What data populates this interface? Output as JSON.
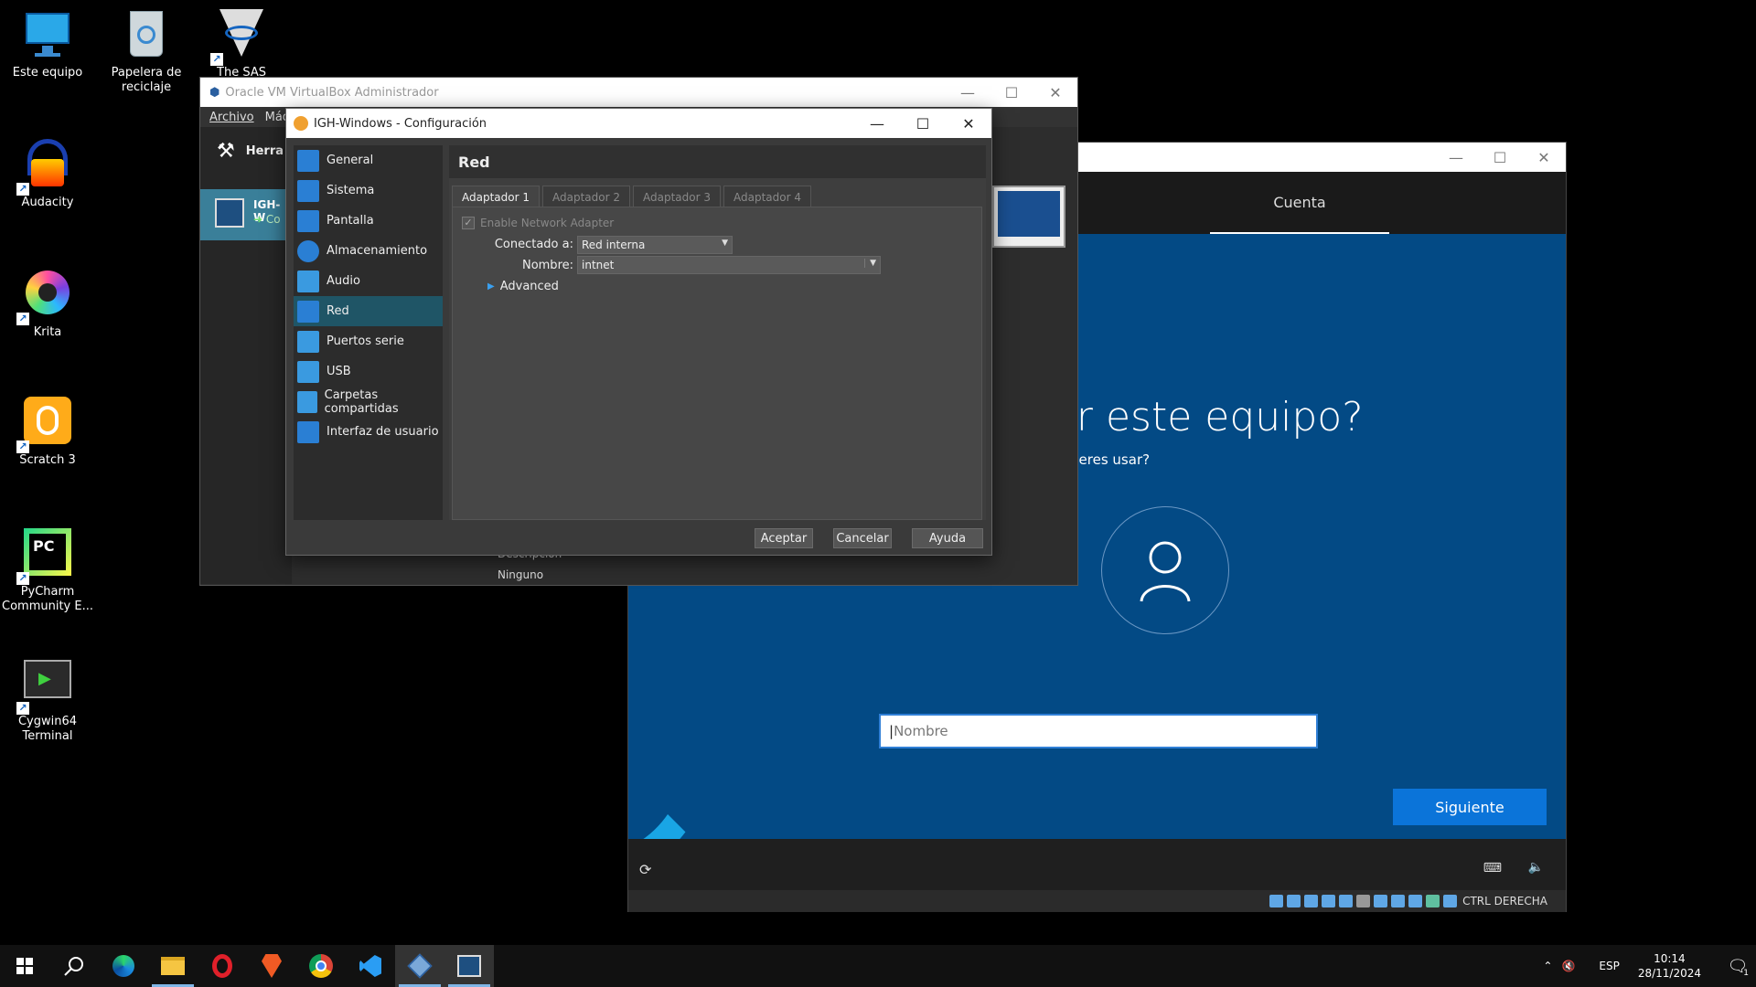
{
  "desktop_icons": [
    {
      "label": "Este equipo",
      "icon": "computer-icon"
    },
    {
      "label": "Papelera de reciclaje",
      "icon": "recycle-bin-icon"
    },
    {
      "label": "The SAS System",
      "icon": "sas-icon"
    },
    {
      "label": "Audacity",
      "icon": "audacity-icon"
    },
    {
      "label": "Krita",
      "icon": "krita-icon"
    },
    {
      "label": "Scratch 3",
      "icon": "scratch-icon"
    },
    {
      "label": "PyCharm Community E...",
      "icon": "pycharm-icon"
    },
    {
      "label": "Cygwin64 Terminal",
      "icon": "cygwin-icon"
    }
  ],
  "manager": {
    "title": "Oracle VM VirtualBox Administrador",
    "menu": [
      "Archivo",
      "Máqu"
    ],
    "tools_label": "Herra",
    "vm_label": "IGH-W",
    "vm_state": "Co",
    "detail_section": "Descripción",
    "detail_value": "Ninguno"
  },
  "dialog": {
    "title": "IGH-Windows - Configuración",
    "nav": [
      {
        "label": "General",
        "icon": "general-icon"
      },
      {
        "label": "Sistema",
        "icon": "system-icon"
      },
      {
        "label": "Pantalla",
        "icon": "display-icon"
      },
      {
        "label": "Almacenamiento",
        "icon": "storage-icon"
      },
      {
        "label": "Audio",
        "icon": "audio-icon"
      },
      {
        "label": "Red",
        "icon": "network-icon",
        "active": true
      },
      {
        "label": "Puertos serie",
        "icon": "serial-port-icon"
      },
      {
        "label": "USB",
        "icon": "usb-icon"
      },
      {
        "label": "Carpetas compartidas",
        "icon": "shared-folder-icon"
      },
      {
        "label": "Interfaz de usuario",
        "icon": "user-interface-icon"
      }
    ],
    "section_title": "Red",
    "tabs": [
      "Adaptador 1",
      "Adaptador 2",
      "Adaptador 3",
      "Adaptador 4"
    ],
    "enable_adapter_label": "Enable Network Adapter",
    "enable_adapter_checked": true,
    "attached_label": "Conectado a:",
    "attached_value": "Red interna",
    "name_label": "Nombre:",
    "name_value": "intnet",
    "advanced_label": "Advanced",
    "buttons": {
      "ok": "Aceptar",
      "cancel": "Cancelar",
      "help": "Ayuda"
    }
  },
  "vm_window": {
    "tab_label": "Cuenta",
    "heading": "sar este equipo?",
    "subheading": "bre quieres usar?",
    "name_placeholder": "Nombre",
    "next_button": "Siguiente",
    "host_key": "CTRL DERECHA"
  },
  "taskbar": {
    "apps": [
      "start-icon",
      "search-icon",
      "edge-icon",
      "file-explorer-icon",
      "opera-icon",
      "brave-icon",
      "chrome-icon",
      "vscode-icon",
      "virtualbox-icon",
      "vm-window-icon"
    ],
    "language": "ESP",
    "time": "10:14",
    "date": "28/11/2024",
    "notification_count": "1"
  },
  "colors": {
    "accent": "#0b74d9",
    "selected_nav": "#1f5566",
    "oobe_blue": "#034a85"
  }
}
